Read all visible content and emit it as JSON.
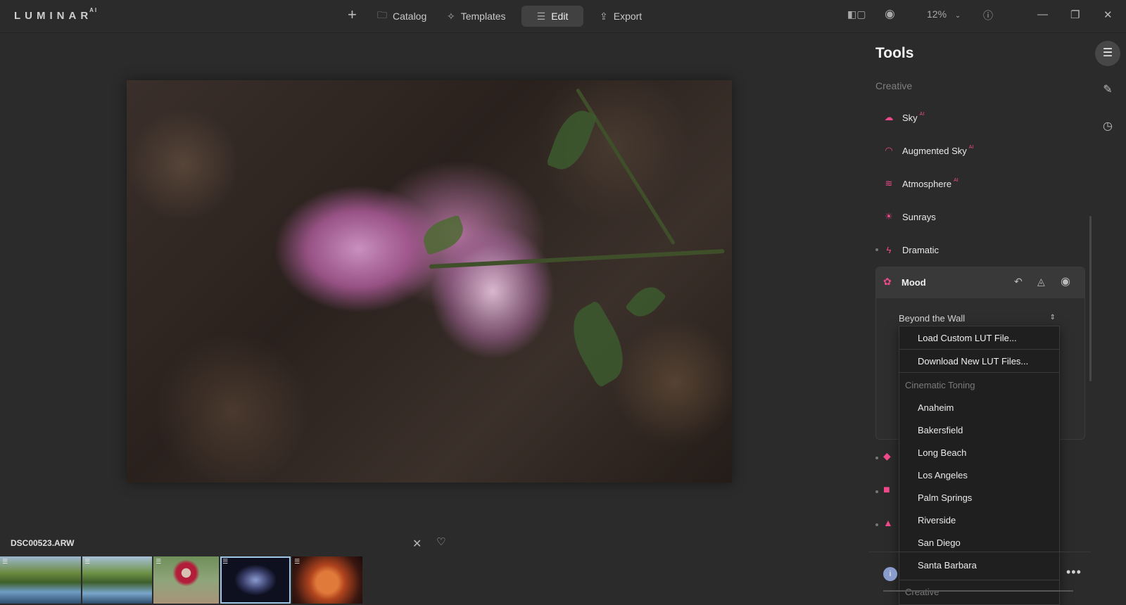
{
  "app": {
    "logo": "LUMINAR",
    "logo_sup": "AI"
  },
  "nav": {
    "add_icon": "plus-icon",
    "catalog": "Catalog",
    "templates": "Templates",
    "edit": "Edit",
    "export": "Export"
  },
  "toolbar": {
    "zoom": "12%"
  },
  "canvas": {
    "filename": "DSC00523.ARW"
  },
  "tools": {
    "title": "Tools",
    "section": "Creative",
    "items": [
      {
        "label": "Sky",
        "ai": "AI",
        "icon": "cloud-icon"
      },
      {
        "label": "Augmented Sky",
        "ai": "AI",
        "icon": "augmented-sky-icon"
      },
      {
        "label": "Atmosphere",
        "ai": "AI",
        "icon": "atmosphere-icon"
      },
      {
        "label": "Sunrays",
        "ai": "",
        "icon": "sun-icon"
      },
      {
        "label": "Dramatic",
        "ai": "",
        "icon": "lightning-icon"
      }
    ],
    "mood": {
      "label": "Mood",
      "lut_selected": "Beyond the Wall"
    }
  },
  "dropdown": {
    "actions": [
      "Load Custom LUT File...",
      "Download New LUT Files..."
    ],
    "group_cinematic": "Cinematic Toning",
    "options": [
      "Anaheim",
      "Bakersfield",
      "Long Beach",
      "Los Angeles",
      "Palm Springs",
      "Riverside",
      "San Diego",
      "Santa Barbara"
    ],
    "group_creative": "Creative"
  },
  "colors": {
    "accent": "#ee4a8a",
    "selected_thumb": "#9dc6e6"
  }
}
